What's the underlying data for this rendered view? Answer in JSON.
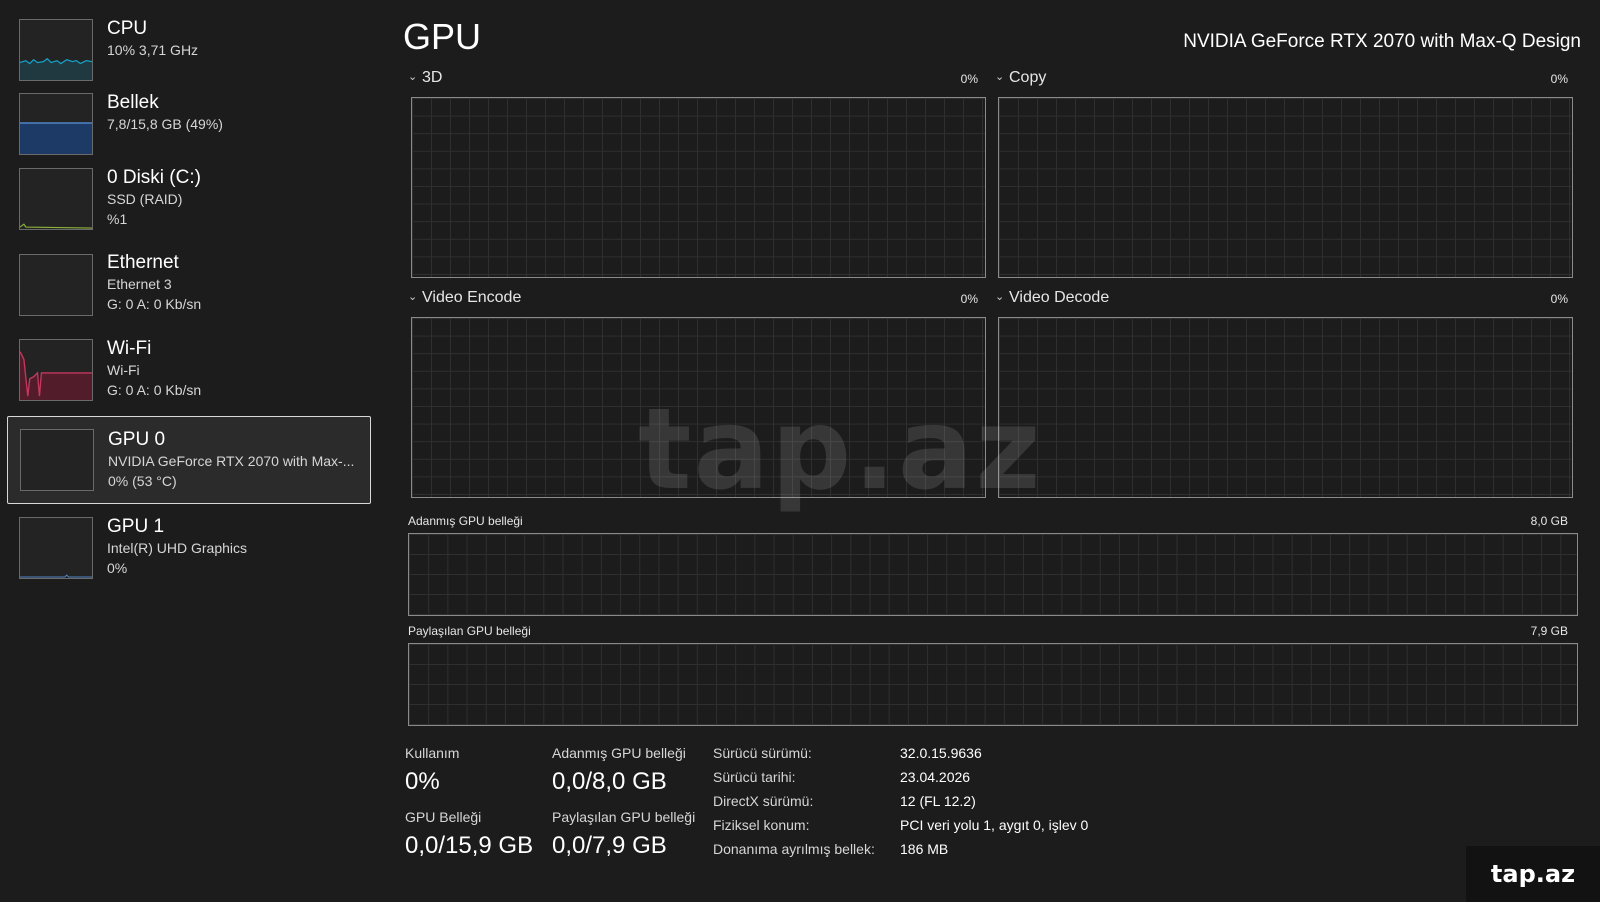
{
  "sidebar": {
    "items": [
      {
        "title": "CPU",
        "lines": [
          "10%  3,71 GHz",
          ""
        ],
        "color": "#17a0c7"
      },
      {
        "title": "Bellek",
        "lines": [
          "7,8/15,8 GB (49%)",
          ""
        ],
        "color": "#4f86c6"
      },
      {
        "title": "0 Diski (C:)",
        "lines": [
          "SSD (RAID)",
          "%1"
        ],
        "color": "#8fb33a"
      },
      {
        "title": "Ethernet",
        "lines": [
          "Ethernet 3",
          "G: 0 A: 0 Kb/sn"
        ],
        "color": "#d0a050"
      },
      {
        "title": "Wi-Fi",
        "lines": [
          "Wi-Fi",
          "G: 0 A: 0 Kb/sn"
        ],
        "color": "#c2385f"
      },
      {
        "title": "GPU 0",
        "lines": [
          "NVIDIA GeForce RTX 2070 with Max-...",
          "0%  (53 °C)"
        ],
        "color": "#4f86c6"
      },
      {
        "title": "GPU 1",
        "lines": [
          "Intel(R) UHD Graphics",
          "0%"
        ],
        "color": "#4f86c6"
      }
    ],
    "selected_index": 5
  },
  "header": {
    "title": "GPU",
    "device": "NVIDIA GeForce RTX 2070 with Max-Q Design"
  },
  "engines": [
    {
      "label": "3D",
      "value": "0%"
    },
    {
      "label": "Copy",
      "value": "0%"
    },
    {
      "label": "Video Encode",
      "value": "0%"
    },
    {
      "label": "Video Decode",
      "value": "0%"
    }
  ],
  "memory_graphs": {
    "dedicated": {
      "label": "Adanmış GPU belleği",
      "max": "8,0 GB"
    },
    "shared": {
      "label": "Paylaşılan GPU belleği",
      "max": "7,9 GB"
    }
  },
  "stats": {
    "usage": {
      "label": "Kullanım",
      "value": "0%"
    },
    "dedicated": {
      "label": "Adanmış GPU belleği",
      "value": "0,0/8,0 GB"
    },
    "gpu_memory": {
      "label": "GPU Belleği",
      "value": "0,0/15,9 GB"
    },
    "shared": {
      "label": "Paylaşılan GPU belleği",
      "value": "0,0/7,9 GB"
    }
  },
  "details": [
    {
      "key": "Sürücü sürümü:",
      "value": "32.0.15.9636"
    },
    {
      "key": "Sürücü tarihi:",
      "value": "23.04.2026"
    },
    {
      "key": "DirectX sürümü:",
      "value": "12 (FL 12.2)"
    },
    {
      "key": "Fiziksel konum:",
      "value": "PCI veri yolu 1, aygıt 0, işlev 0"
    },
    {
      "key": "Donanıma ayrılmış bellek:",
      "value": "186 MB"
    }
  ],
  "watermark": "tap.az",
  "corner_logo": "tap.az"
}
